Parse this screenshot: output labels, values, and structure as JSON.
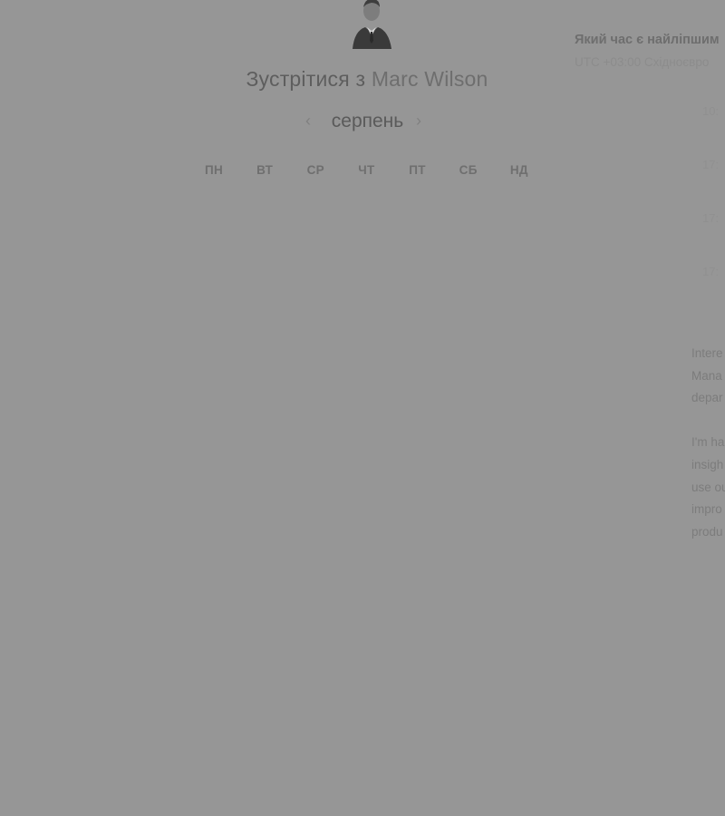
{
  "meeting": {
    "title_prefix": "Зустрітися з ",
    "host_name": "Marc Wilson"
  },
  "month_nav": {
    "month": "серпень",
    "prev_icon": "chevron-left-icon",
    "next_icon": "chevron-right-icon"
  },
  "calendar": {
    "weekdays": [
      "ПН",
      "ВТ",
      "СР",
      "ЧТ",
      "ПТ",
      "СБ",
      "НД"
    ],
    "weeks": [
      [
        "",
        "",
        "",
        "",
        "",
        "",
        ""
      ],
      [
        "",
        "",
        "",
        "",
        "",
        "",
        ""
      ],
      [
        "",
        "",
        "",
        "",
        "",
        "",
        ""
      ],
      [
        "",
        "",
        "",
        "",
        "",
        "",
        ""
      ],
      [
        "",
        "",
        "",
        "",
        "",
        "",
        ""
      ]
    ]
  },
  "booking": {
    "question": "Який час є найліпшим",
    "timezone": "UTC +03:00 Східноєвро",
    "slots": [
      "10:",
      "17:",
      "17:",
      "17:"
    ]
  },
  "description": {
    "paragraphs": [
      [
        "Intere",
        "Mana",
        "depar"
      ],
      [
        "I'm ha",
        "insigh",
        "use ou",
        "impro",
        "produ"
      ]
    ]
  },
  "colors": {
    "overlay": "#969696",
    "title_text": "#5e5e5e",
    "muted_text": "#8f8f8f"
  }
}
